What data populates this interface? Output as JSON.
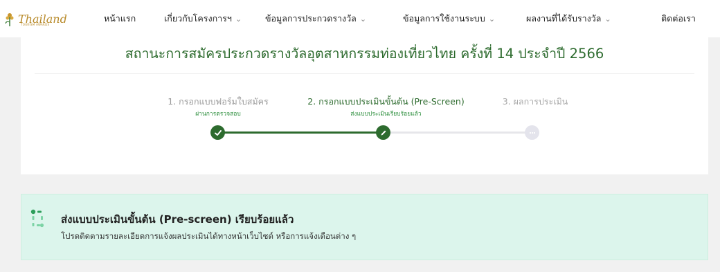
{
  "brand": {
    "logo_text": "Thailand",
    "logo_sub": "TOURISM AWARDS"
  },
  "nav": {
    "items": [
      {
        "label": "หน้าแรก",
        "dropdown": false
      },
      {
        "label": "เกี่ยวกับโครงการฯ",
        "dropdown": true
      },
      {
        "label": "ข้อมูลการประกวดรางวัล",
        "dropdown": true
      },
      {
        "label": "ข้อมูลการใช้งานระบบ",
        "dropdown": true
      },
      {
        "label": "ผลงานที่ได้รับรางวัล",
        "dropdown": true
      },
      {
        "label": "ติดต่อเรา",
        "dropdown": false
      }
    ],
    "caret": "⌄"
  },
  "main": {
    "title": "สถานะการสมัครประกวดรางวัลอุตสาหกรรมท่องเที่ยวไทย ครั้งที่ 14 ประจำปี 2566",
    "steps": [
      {
        "label": "1. กรอกแบบฟอร์มใบสมัคร",
        "sub": "ผ่านการตรวจสอบ",
        "status": "done"
      },
      {
        "label": "2. กรอกแบบประเมินขั้นต้น (Pre-Screen)",
        "sub": "ส่งแบบประเมินเรียบร้อยแล้ว",
        "status": "active"
      },
      {
        "label": "3. ผลการประเมิน",
        "sub": "",
        "status": "pending"
      }
    ]
  },
  "notice": {
    "title": "ส่งแบบประเมินขั้นต้น (Pre-screen) เรียบร้อยแล้ว",
    "text": "โปรดติดตามรายละเอียดการแจ้งผลประเมินได้ทางหน้าเว็บไซต์ หรือการแจ้งเตือนต่าง ๆ"
  },
  "colors": {
    "brand_green": "#2d6b2e",
    "notice_bg": "#dcf5ec",
    "gold": "#b88a2a"
  }
}
